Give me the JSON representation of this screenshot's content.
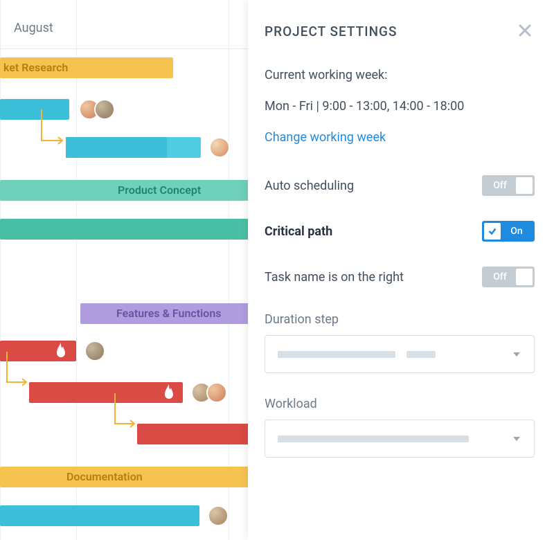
{
  "gantt": {
    "month": "August",
    "groups": [
      {
        "label": "ket Research",
        "color": "#f5bd4a",
        "textColor": "#c07f0e"
      },
      {
        "label": "Product Concept",
        "color": "#49bfa6",
        "textColor": "#1e866f"
      },
      {
        "label": "Features & Functions",
        "color": "#a98dd8",
        "textColor": "#6b4fa3"
      },
      {
        "label": "Documentation",
        "color": "#f5bd4a",
        "textColor": "#c07f0e"
      }
    ],
    "bars": [
      {
        "id": "mr-1",
        "color": "#3cc0d9"
      },
      {
        "id": "mr-2",
        "color": "#3cc0d9"
      },
      {
        "id": "pc-1",
        "color": "#49bfa6"
      },
      {
        "id": "ff-1",
        "color": "#d94b44"
      },
      {
        "id": "ff-2",
        "color": "#d94b44"
      },
      {
        "id": "ff-3",
        "color": "#d94b44"
      },
      {
        "id": "doc-1",
        "color": "#3cc0d9"
      }
    ]
  },
  "settings": {
    "title": "PROJECT SETTINGS",
    "working_week_label": "Current working week:",
    "working_week_value": "Mon - Fri | 9:00 - 13:00, 14:00 - 18:00",
    "change_link": "Change working week",
    "toggles": {
      "auto_scheduling": {
        "label": "Auto scheduling",
        "state": "off",
        "text": "Off"
      },
      "critical_path": {
        "label": "Critical path",
        "state": "on",
        "text": "On"
      },
      "task_name_right": {
        "label": "Task name is on the right",
        "state": "off",
        "text": "Off"
      }
    },
    "duration_step_label": "Duration step",
    "workload_label": "Workload"
  }
}
